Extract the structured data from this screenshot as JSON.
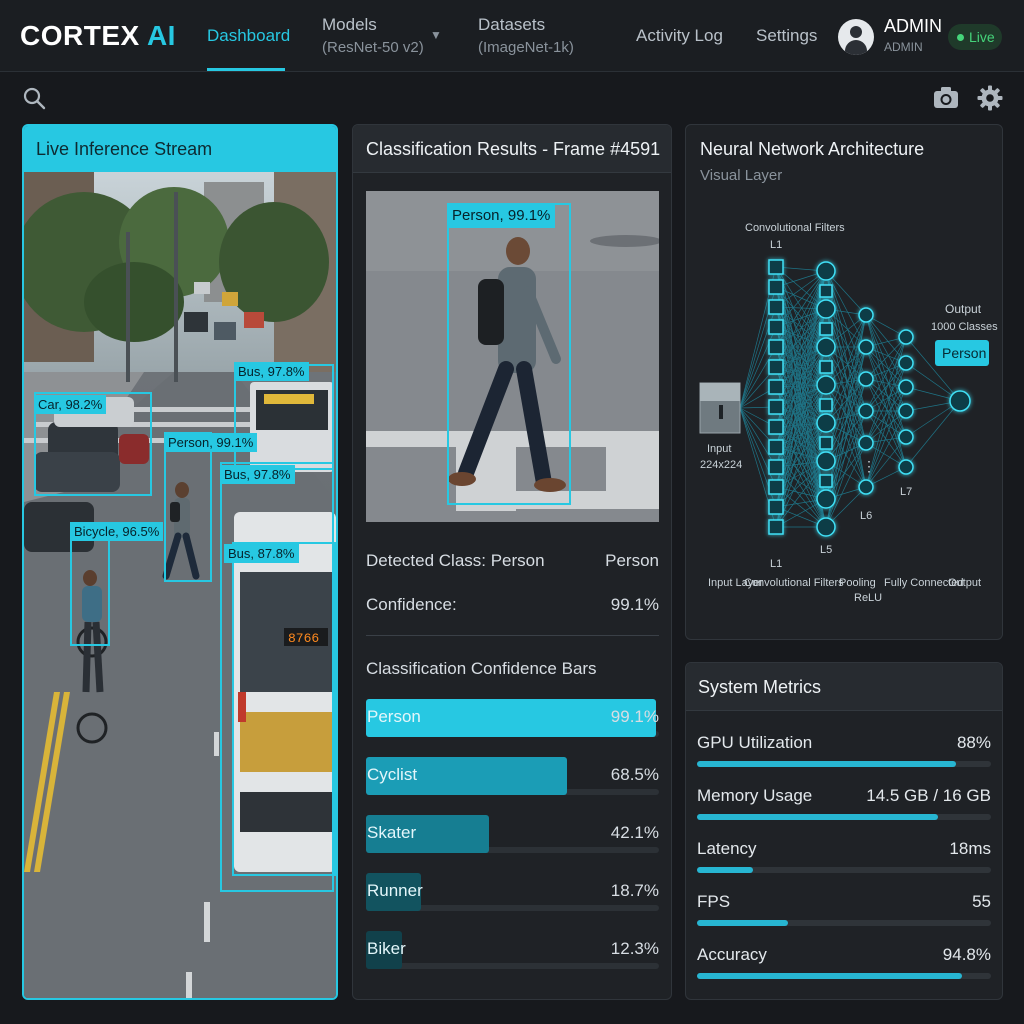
{
  "brand": {
    "name": "CORTEX",
    "accent": "AI"
  },
  "nav": {
    "dashboard": "Dashboard",
    "models": {
      "label": "Models",
      "sub": "(ResNet-50 v2)"
    },
    "datasets": {
      "label": "Datasets",
      "sub": "(ImageNet-1k)"
    },
    "activity": "Activity Log",
    "settings": "Settings"
  },
  "user": {
    "name": "ADMIN",
    "role": "ADMIN",
    "status": "Live"
  },
  "icons": {
    "search": "search-icon",
    "camera": "camera-icon",
    "settings": "gear-icon",
    "user": "user-avatar-icon",
    "dropdown": "chevron-down-icon"
  },
  "stream": {
    "title": "Live Inference Stream",
    "detections": [
      {
        "label": "Bus, 97.8%"
      },
      {
        "label": "Car, 98.2%"
      },
      {
        "label": "Person, 99.1%"
      },
      {
        "label": "Bus, 97.8%"
      },
      {
        "label": "Bicycle, 96.5%"
      },
      {
        "label": "Bus, 87.8%"
      }
    ],
    "bus_number": "8766"
  },
  "results": {
    "title": "Classification Results - Frame #4591",
    "frame_label": "Person, 99.1%",
    "detected_label": "Detected Class: Person",
    "detected_value": "Person",
    "confidence_label": "Confidence:",
    "confidence_value": "99.1%",
    "bars_title": "Classification Confidence Bars",
    "bars": [
      {
        "label": "Person",
        "value": "99.1%",
        "fraction": 0.991
      },
      {
        "label": "Cyclist",
        "value": "68.5%",
        "fraction": 0.685
      },
      {
        "label": "Skater",
        "value": "42.1%",
        "fraction": 0.421
      },
      {
        "label": "Runner",
        "value": "18.7%",
        "fraction": 0.187
      },
      {
        "label": "Biker",
        "value": "12.3%",
        "fraction": 0.123
      }
    ]
  },
  "network": {
    "title": "Neural Network Architecture",
    "subtitle": "Visual Layer",
    "top_labels": {
      "conv": "Convolutional  Filters",
      "l1": "L1",
      "output": "Output",
      "classes": "1000 Classes",
      "badge": "Person"
    },
    "input_label": "Input",
    "input_size": "224x224",
    "layer_tags": {
      "l1": "L1",
      "l5": "L5",
      "l6": "L6",
      "l7": "L7"
    },
    "bottom_labels": {
      "input": "Input Layer",
      "conv": "Convolutional Filters",
      "pooling": "Pooling",
      "relu": "ReLU",
      "fc": "Fully Connected",
      "output": "Output"
    }
  },
  "metrics": {
    "title": "System Metrics",
    "items": [
      {
        "label": "GPU Utilization",
        "value": "88%",
        "fraction": 0.88
      },
      {
        "label": "Memory Usage",
        "value": "14.5 GB / 16 GB",
        "fraction": 0.82
      },
      {
        "label": "Latency",
        "value": "18ms",
        "fraction": 0.19
      },
      {
        "label": "FPS",
        "value": "55",
        "fraction": 0.31
      },
      {
        "label": "Accuracy",
        "value": "94.8%",
        "fraction": 0.9
      }
    ]
  },
  "colors": {
    "accent": "#27c8e2",
    "live": "#45d47a",
    "background": "#17191d",
    "panel": "#1f2226"
  }
}
